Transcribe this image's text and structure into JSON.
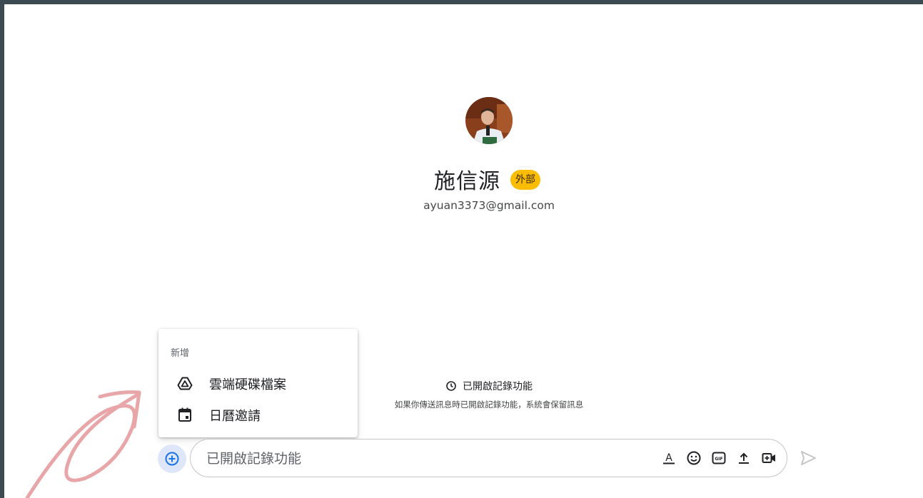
{
  "contact": {
    "name": "施信源",
    "badge": "外部",
    "email": "ayuan3373@gmail.com"
  },
  "history": {
    "status": "已開啟記錄功能",
    "description": "如果你傳送訊息時已開啟記錄功能，系統會保留訊息"
  },
  "add_menu": {
    "heading": "新增",
    "items": [
      {
        "label": "雲端硬碟檔案",
        "icon": "google-drive-icon"
      },
      {
        "label": "日曆邀請",
        "icon": "calendar-icon"
      }
    ]
  },
  "composer": {
    "placeholder": "已開啟記錄功能",
    "value": "",
    "tools": [
      "format-text-icon",
      "emoji-icon",
      "gif-icon",
      "upload-icon",
      "video-meeting-icon"
    ],
    "send_icon": "send-icon"
  },
  "colors": {
    "badge_bg": "#fbbc04",
    "accent_blue": "#1a73e8",
    "add_button_bg": "#dde7f9",
    "frame": "#3c4a52",
    "annotation": "#e8a6a8"
  }
}
